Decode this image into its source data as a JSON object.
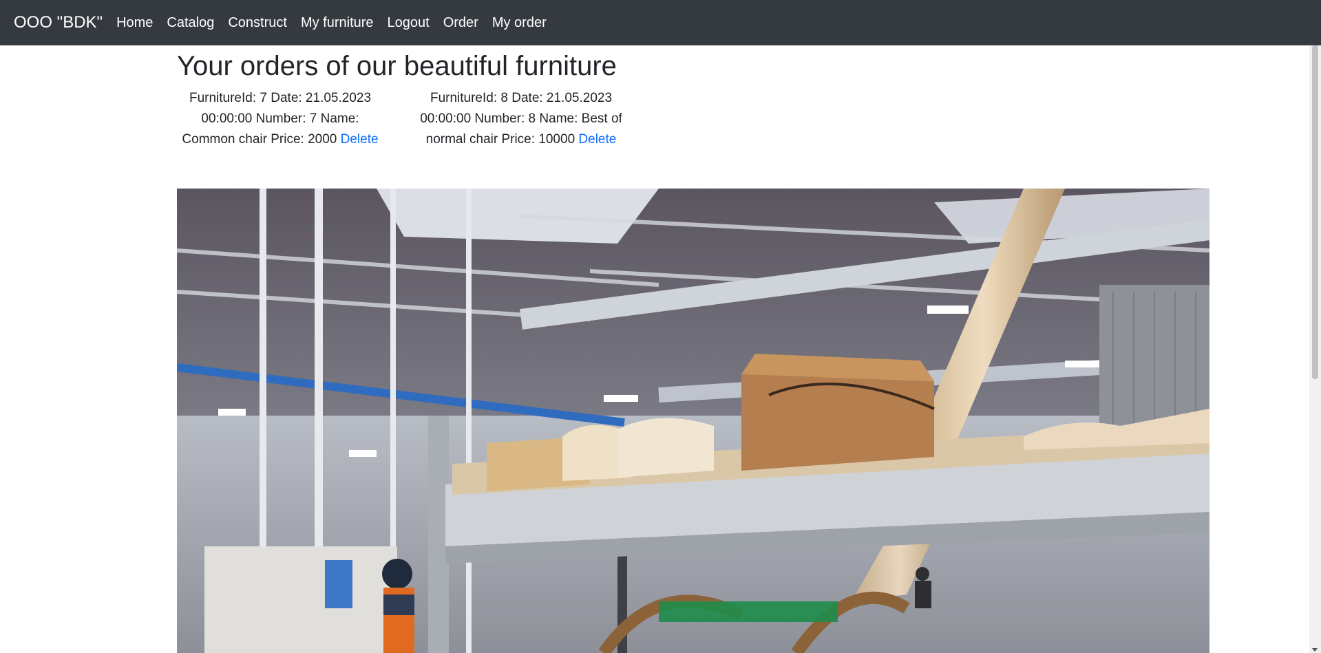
{
  "navbar": {
    "brand": "OOO \"BDK\"",
    "links": [
      "Home",
      "Catalog",
      "Construct",
      "My furniture",
      "Logout",
      "Order",
      "My order"
    ]
  },
  "page": {
    "title": "Your orders of our beautiful furniture"
  },
  "orders": [
    {
      "text": "FurnitureId: 7 Date: 21.05.2023 00:00:00 Number: 7 Name: Common chair Price: 2000",
      "delete_label": "Delete"
    },
    {
      "text": "FurnitureId: 8 Date: 21.05.2023 00:00:00 Number: 8 Name: Best of normal chair Price: 10000",
      "delete_label": "Delete"
    }
  ],
  "image": {
    "description_icon": "furniture-factory-photo"
  },
  "colors": {
    "navbar_bg": "#343a40",
    "link": "#0d6efd"
  }
}
